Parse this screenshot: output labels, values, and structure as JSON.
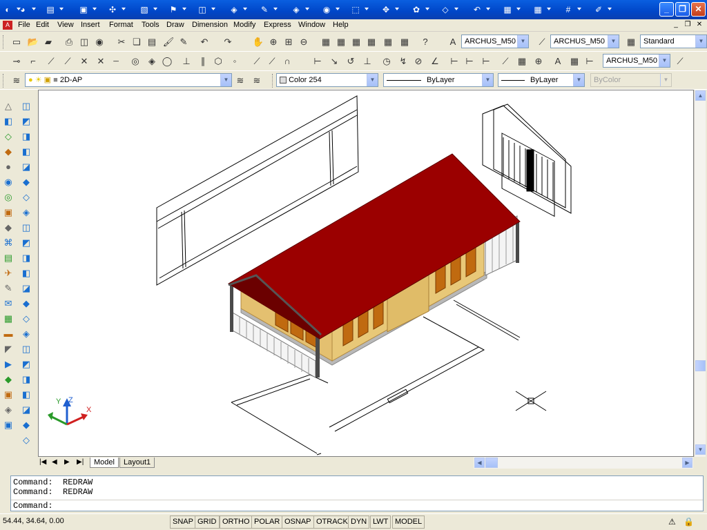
{
  "title_icons": [
    "autocad-logo-icon",
    "3d-orbit-icon",
    "layer-icon",
    "viewport-icon",
    "snap-icon",
    "cube-icon",
    "flag-icon",
    "box-icon",
    "solid-icon",
    "pen-icon",
    "layers-icon",
    "match-icon",
    "select-icon",
    "move-icon",
    "gear-icon",
    "plane-icon",
    "undo-icon",
    "block-icon",
    "table-icon",
    "count-icon",
    "pencil-icon"
  ],
  "menu": [
    "File",
    "Edit",
    "View",
    "Insert",
    "Format",
    "Tools",
    "Draw",
    "Dimension",
    "Modify",
    "Express",
    "Window",
    "Help"
  ],
  "toolbar1": {
    "text_style": "ARCHUS_M50",
    "dim_style": "ARCHUS_M50",
    "table_style": "Standard"
  },
  "toolbar2": {
    "multileader_style": "ARCHUS_M50"
  },
  "toolbar3": {
    "layer": "2D-AP",
    "color": "Color 254",
    "linetype": "ByLayer",
    "lineweight": "ByLayer",
    "plotstyle": "ByColor"
  },
  "ucs": {
    "x": "X",
    "y": "Y",
    "z": "Z"
  },
  "tabs": {
    "model": "Model",
    "layout": "Layout1"
  },
  "command": {
    "history": [
      "Command:  REDRAW",
      "Command:  REDRAW"
    ],
    "prompt": "Command:"
  },
  "status": {
    "coords": "54.44, 34.64, 0.00",
    "buttons": [
      "SNAP",
      "GRID",
      "ORTHO",
      "POLAR",
      "OSNAP",
      "OTRACK",
      "DYN",
      "LWT",
      "MODEL"
    ]
  },
  "colors": {
    "roof": "#9b0000",
    "wall": "#e8c878",
    "window": "#c06a10",
    "title": "#0a5fe0"
  }
}
